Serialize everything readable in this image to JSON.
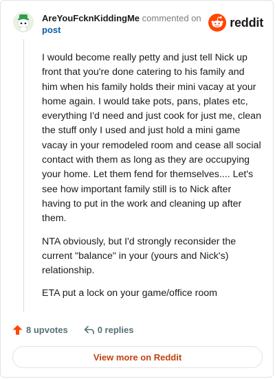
{
  "comment": {
    "username": "AreYouFcknKiddingMe",
    "action_text": "commented on",
    "post_link": "post",
    "paragraphs": [
      "I would become really petty and just tell Nick up front that you're done catering to his family and him when his family holds their mini vacay at your home again. I would take pots, pans, plates etc, everything I'd need and just cook for just me, clean the stuff only I used and just hold a mini game vacay in your remodeled room and cease all social contact with them as long as they are occupying your home. Let them fend for themselves.... Let's see how important family still is to Nick after having to put in the work and cleaning up after them.",
      "NTA obviously, but I'd strongly reconsider the current \"balance\" in your (yours and Nick's) relationship.",
      "ETA put a lock on your game/office room"
    ],
    "upvotes": "8 upvotes",
    "replies": "0 replies"
  },
  "brand": {
    "wordmark": "reddit",
    "icon": "reddit-logo-icon",
    "accent": "#ff4500"
  },
  "footer": {
    "view_more": "View more on Reddit",
    "view_more_color": "#c2410c"
  },
  "colors": {
    "upvote": "#ff4500",
    "link": "#0a5ba8",
    "muted": "#576f76"
  }
}
